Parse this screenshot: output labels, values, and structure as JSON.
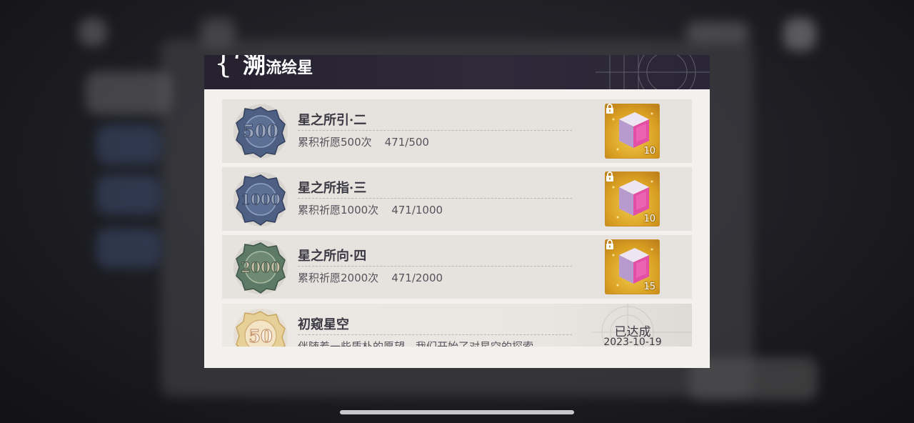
{
  "dialog": {
    "title_brace": "{‘",
    "title_big": "溯",
    "title_small": "流绘星"
  },
  "achievements": [
    {
      "medal_number": "500",
      "title": "星之所引·二",
      "description": "累积祈愿500次",
      "progress": "471/500",
      "reward": {
        "icon": "gift-cube-icon",
        "count": "10",
        "locked": true
      }
    },
    {
      "medal_number": "1000",
      "title": "星之所指·三",
      "description": "累积祈愿1000次",
      "progress": "471/1000",
      "reward": {
        "icon": "gift-cube-icon",
        "count": "10",
        "locked": true
      }
    },
    {
      "medal_number": "2000",
      "title": "星之所向·四",
      "description": "累积祈愿2000次",
      "progress": "471/2000",
      "reward": {
        "icon": "gift-cube-icon",
        "count": "15",
        "locked": true
      }
    },
    {
      "medal_number": "50",
      "title": "初窥星空",
      "description": "伴随着一些质朴的愿望，我们开始了对星空的探索",
      "status": "已达成",
      "date": "2023-10-19"
    }
  ],
  "colors": {
    "medal_blue": "#4d5f83",
    "medal_green": "#5c7a66",
    "medal_gold": "#d7b873",
    "reward_gold": "#e0a72a",
    "header_dark": "#25212f"
  }
}
